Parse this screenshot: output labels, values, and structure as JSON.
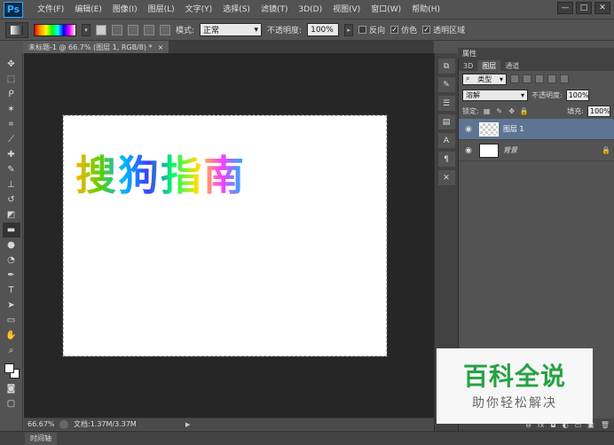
{
  "app": {
    "logo": "Ps",
    "menus": [
      "文件(F)",
      "编辑(E)",
      "图像(I)",
      "图层(L)",
      "文字(Y)",
      "选择(S)",
      "滤镜(T)",
      "3D(D)",
      "视图(V)",
      "窗口(W)",
      "帮助(H)"
    ],
    "window_controls": [
      "—",
      "□",
      "✕"
    ]
  },
  "options": {
    "mode_label": "模式:",
    "mode_value": "正常",
    "opacity_label": "不透明度:",
    "opacity_value": "100%",
    "reverse_label": "反向",
    "dither_label": "仿色",
    "transparency_label": "透明区域"
  },
  "document": {
    "tab_title": "未标题-1 @ 66.7% (图层 1, RGB/8) *",
    "tab_close": "×",
    "canvas_text": "搜狗指南"
  },
  "status": {
    "zoom": "66.67%",
    "doc_info": "文档:1.37M/3.37M",
    "arrow": "▶"
  },
  "timeline": {
    "tab": "时间轴"
  },
  "panels": {
    "properties_tab": "属性",
    "tabs": [
      "3D",
      "图层",
      "通道"
    ],
    "filter_type": "类型",
    "blend_mode": "溶解",
    "opacity_label": "不透明度:",
    "opacity_value": "100%",
    "lock_label": "锁定:",
    "fill_label": "填充:",
    "fill_value": "100%",
    "layers": [
      {
        "name": "图层 1",
        "selected": true
      },
      {
        "name": "背景",
        "selected": false
      }
    ],
    "footer_buttons": [
      "⊖",
      "fx",
      "◘",
      "◐",
      "▭",
      "▣",
      "🗑"
    ]
  },
  "watermark": {
    "title": "百科全说",
    "subtitle": "助你轻松解决"
  },
  "icons": {
    "tools": [
      "move-icon",
      "marquee-icon",
      "lasso-icon",
      "magic-wand-icon",
      "crop-icon",
      "eyedropper-icon",
      "healing-icon",
      "brush-icon",
      "stamp-icon",
      "history-brush-icon",
      "eraser-icon",
      "gradient-icon",
      "blur-icon",
      "dodge-icon",
      "pen-icon",
      "type-icon",
      "path-select-icon",
      "shape-icon",
      "hand-icon",
      "zoom-icon"
    ]
  },
  "colors": {
    "selected_layer": "#5d7593",
    "watermark_green": "#25a244"
  }
}
